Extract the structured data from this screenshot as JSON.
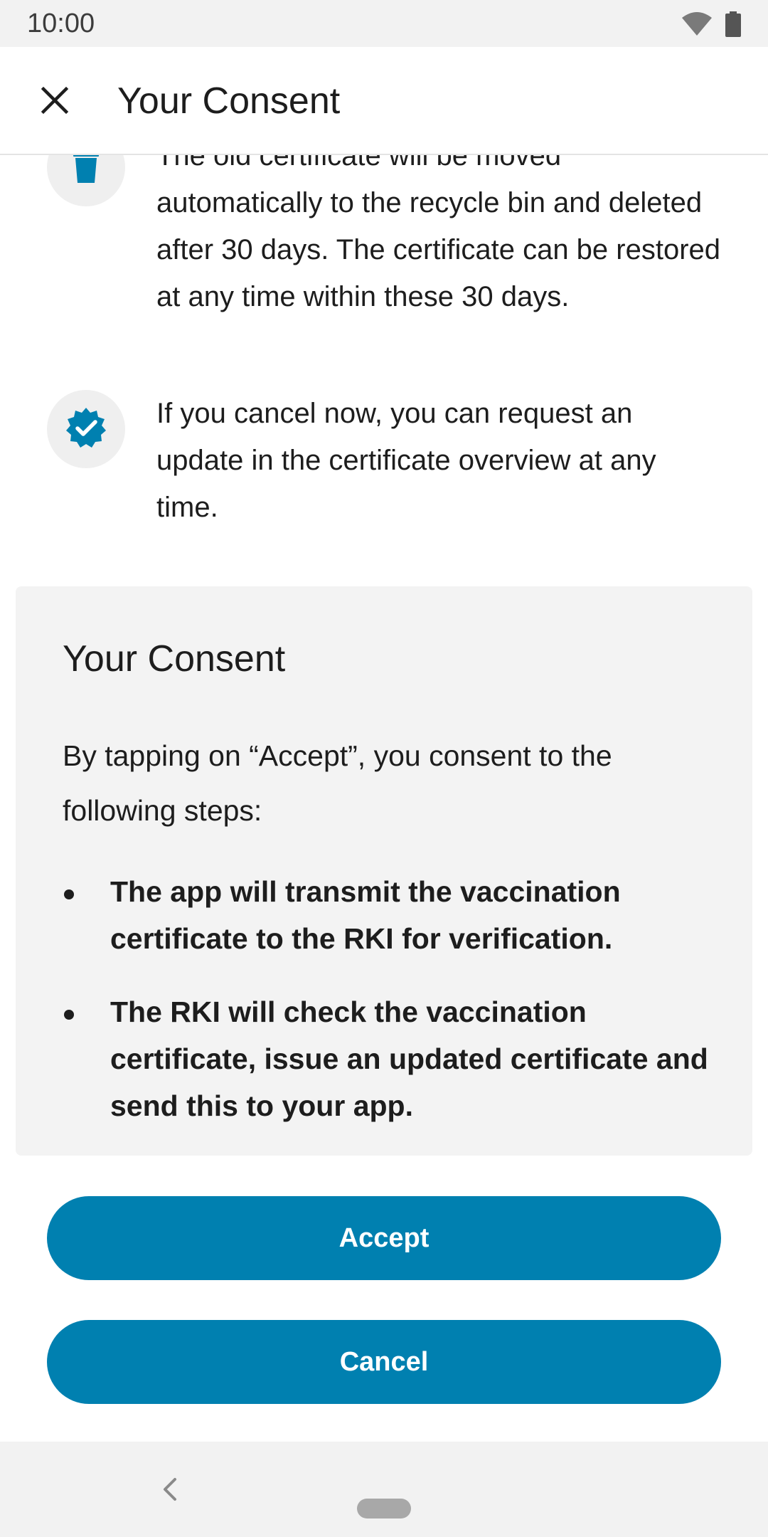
{
  "status_bar": {
    "time": "10:00"
  },
  "app_bar": {
    "title": "Your Consent",
    "close_icon": "close-icon"
  },
  "info_items": [
    {
      "icon": "trash-icon",
      "text": "The old certificate will be moved automatically to the recycle bin and deleted after 30 days. The certificate can be restored at any time within these 30 days."
    },
    {
      "icon": "verified-badge-icon",
      "text": "If you cancel now, you can request an update in the certificate overview at any time."
    }
  ],
  "consent": {
    "title": "Your Consent",
    "intro": "By tapping on “Accept”, you consent to the following steps:",
    "steps": [
      "The app will transmit the vaccination certificate to the RKI for verification.",
      "The RKI will check the vaccination certificate, issue an updated certificate and send this to your app."
    ]
  },
  "buttons": {
    "accept_label": "Accept",
    "cancel_label": "Cancel"
  },
  "colors": {
    "accent": "#0080B0",
    "card_background": "#F3F3F3",
    "icon_circle": "#EFEFEF"
  }
}
